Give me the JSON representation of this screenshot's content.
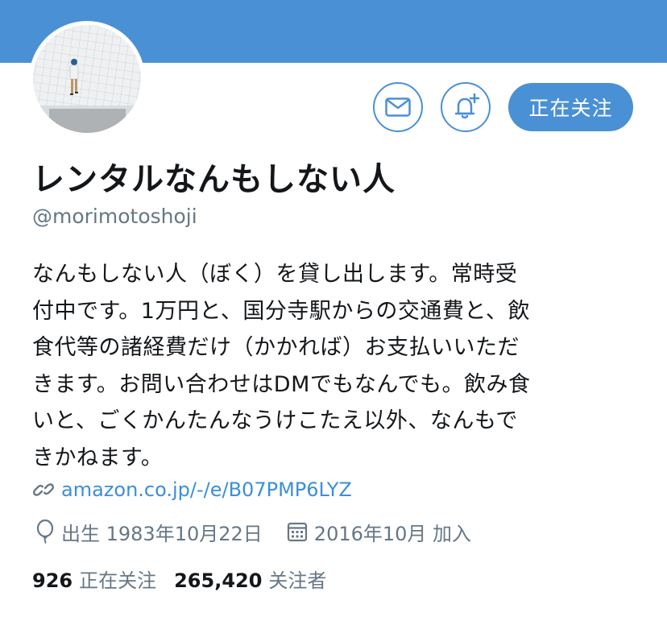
{
  "profile": {
    "display_name": "レンタルなんもしない人",
    "handle": "@morimotoshoji",
    "bio": "なんもしない人（ぼく）を貸し出します。常時受\n付中です。1万円と、国分寺駅からの交通費と、飲\n食代等の諸経費だけ（かかれば）お支払いいただ\nきます。お問い合わせはDMでもなんでも。飲み食\nいと、ごくかんたんなうけこたえ以外、なんもで\nきかねます。",
    "link": "amazon.co.jp/-/e/B07PMP6LYZ",
    "birth": "出生 1983年10月22日",
    "joined": "2016年10月 加入"
  },
  "actions": {
    "follow_label": "正在关注"
  },
  "stats": {
    "following_count": "926",
    "following_label": "正在关注",
    "followers_count": "265,420",
    "followers_label": "关注者"
  },
  "colors": {
    "accent": "#4a90d4",
    "link": "#3b8fd8",
    "text": "#14171a",
    "muted": "#657786"
  },
  "icons": {
    "mail": "mail-icon",
    "bell": "bell-plus-icon",
    "link": "link-icon",
    "birth": "balloon-icon",
    "calendar": "calendar-icon"
  }
}
